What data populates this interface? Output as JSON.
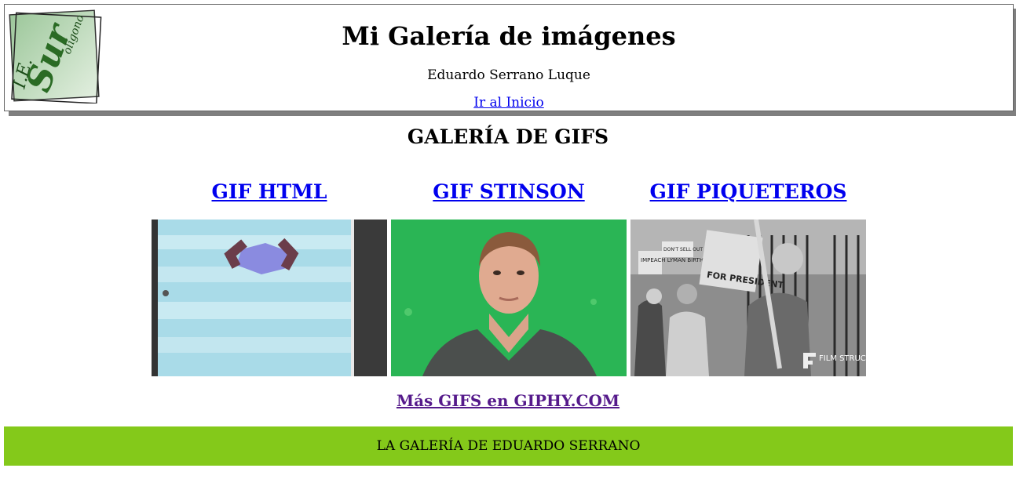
{
  "header": {
    "title": "Mi Galería de imágenes",
    "author": "Eduardo Serrano Luque",
    "home_link": "Ir al Inicio",
    "logo_text": "I.E. Polígono SUR"
  },
  "gallery": {
    "title": "GALERÍA DE GIFS",
    "items": [
      {
        "caption": "GIF HTML"
      },
      {
        "caption": "GIF STINSON"
      },
      {
        "caption": "GIF PIQUETEROS",
        "watermark": "FILM STRUCK",
        "signs": [
          "DON'T SELL OUT",
          "IMPEACH LYMAN BIRTH RIGHT",
          "FOR PRESIDENT"
        ]
      }
    ],
    "more_link": "Más GIFS en GIPHY.COM"
  },
  "footer": {
    "text": "LA GALERÍA DE EDUARDO SERRANO"
  },
  "colors": {
    "footer_bg": "#84c91a",
    "link": "#0000ee",
    "visited_link": "#551a8b",
    "header_shadow": "#7f7f7f"
  }
}
